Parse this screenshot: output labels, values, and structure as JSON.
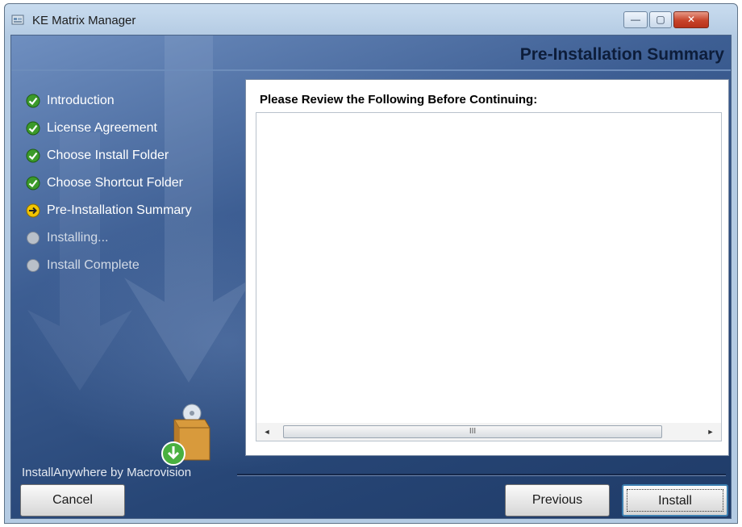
{
  "window": {
    "title": "KE Matrix Manager",
    "controls": {
      "minimize": "—",
      "maximize": "▢",
      "close": "✕"
    }
  },
  "header": {
    "title": "Pre-Installation Summary"
  },
  "steps": [
    {
      "label": "Introduction",
      "status": "complete",
      "icon": "check-icon"
    },
    {
      "label": "License Agreement",
      "status": "complete",
      "icon": "check-icon"
    },
    {
      "label": "Choose Install Folder",
      "status": "complete",
      "icon": "check-icon"
    },
    {
      "label": "Choose Shortcut Folder",
      "status": "complete",
      "icon": "check-icon"
    },
    {
      "label": "Pre-Installation Summary",
      "status": "current",
      "icon": "arrow-right-icon"
    },
    {
      "label": "Installing...",
      "status": "pending",
      "icon": "pending-dot-icon"
    },
    {
      "label": "Install Complete",
      "status": "pending",
      "icon": "pending-dot-icon"
    }
  ],
  "content": {
    "heading": "Please Review the Following Before Continuing:",
    "summary_text": "",
    "scrollbar": {
      "left_arrow": "◄",
      "grip": "III",
      "right_arrow": "►"
    }
  },
  "footer": {
    "brand": "InstallAnywhere by Macrovision"
  },
  "buttons": {
    "cancel": "Cancel",
    "previous": "Previous",
    "install": "Install"
  },
  "colors": {
    "check_green": "#3c9a2a",
    "current_yellow": "#f2c500",
    "pending_gray": "#b9c0c9",
    "panel_blue": "#274676"
  }
}
